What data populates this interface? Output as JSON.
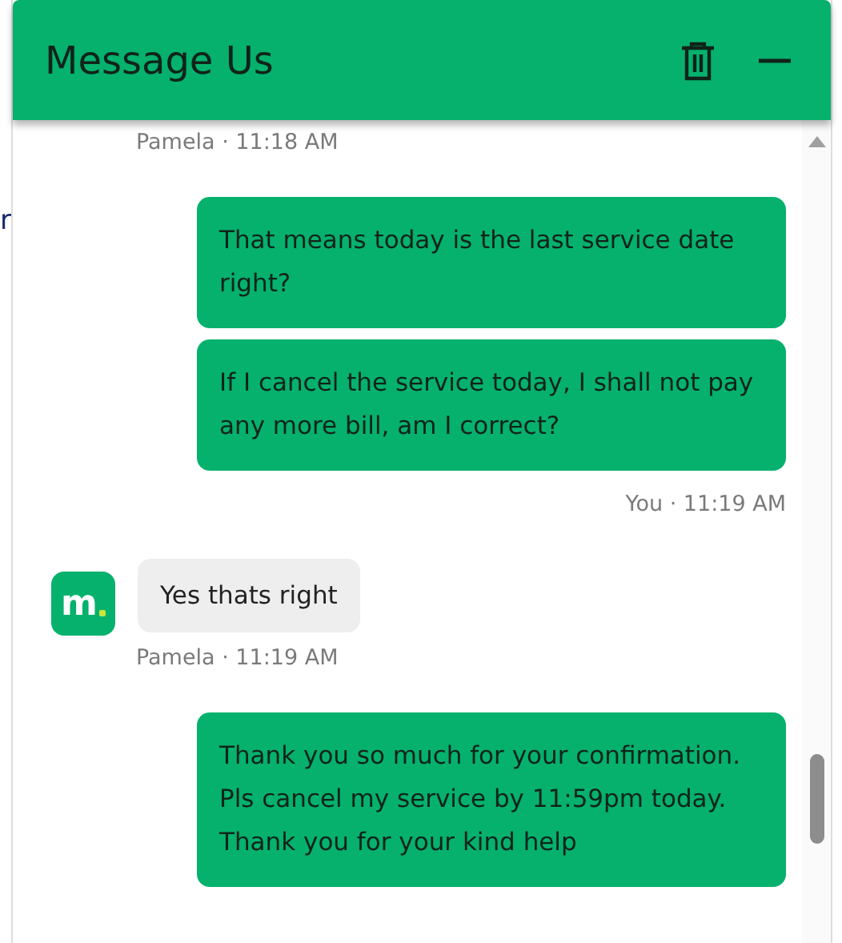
{
  "background_text": "r",
  "header": {
    "title": "Message Us"
  },
  "messages": [
    {
      "kind": "agentstamp",
      "text": "Pamela · 11:18 AM"
    },
    {
      "kind": "sent",
      "text": "That means today is the last service date right?"
    },
    {
      "kind": "sent",
      "text": "If I cancel the service today, I shall not pay any more bill, am I correct?"
    },
    {
      "kind": "userstamp",
      "text": "You · 11:19 AM"
    },
    {
      "kind": "received",
      "avatar": "m",
      "text": "Yes thats right"
    },
    {
      "kind": "agentstamp",
      "text": "Pamela · 11:19 AM"
    },
    {
      "kind": "sent",
      "text": "Thank you so much for your confirmation. Pls cancel my service by 11:59pm today. Thank you for your kind help"
    }
  ]
}
